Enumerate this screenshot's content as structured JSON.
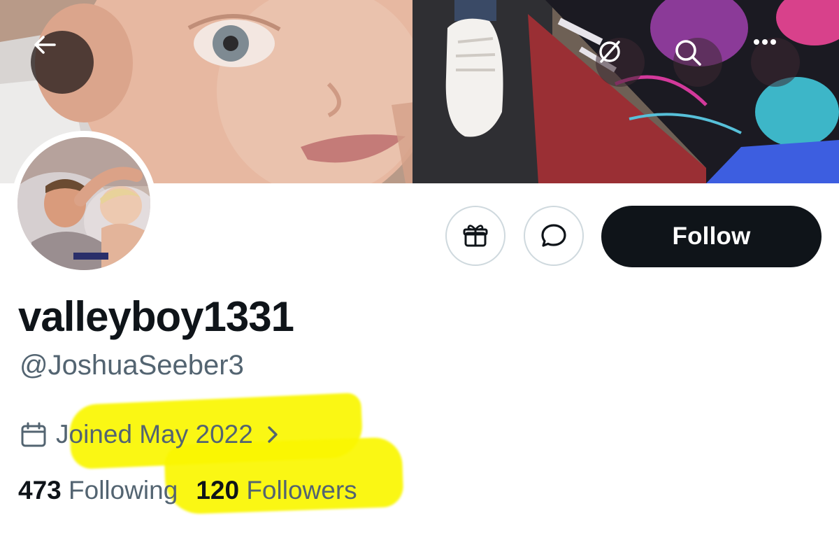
{
  "header": {
    "icons": [
      "back-arrow-icon",
      "translate-icon",
      "search-icon",
      "more-icon"
    ]
  },
  "actions": {
    "follow_label": "Follow",
    "icons": [
      "gift-icon",
      "message-icon"
    ]
  },
  "profile": {
    "display_name": "valleyboy1331",
    "handle": "@JoshuaSeeber3",
    "joined": "Joined May 2022",
    "following_count": "473",
    "following_label": "Following",
    "followers_count": "120",
    "followers_label": "Followers"
  },
  "colors": {
    "follow_button": "#0f1419",
    "secondary_text": "#536471",
    "highlight": "#faf600"
  }
}
